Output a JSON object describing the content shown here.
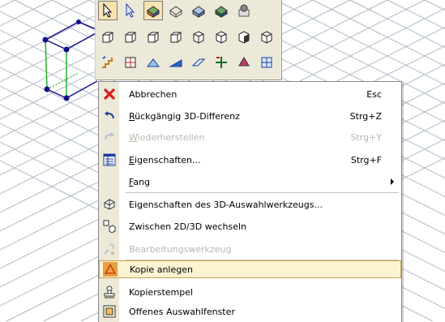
{
  "toolbar": {
    "row1_icons": [
      "pointer-icon",
      "pointer-alt-icon",
      "render-shaded-icon",
      "render-wire-icon",
      "render-hidden-icon",
      "render-color-icon",
      "render-settings-icon"
    ],
    "row2_icons": [
      "box-1-icon",
      "box-2-icon",
      "box-3-icon",
      "box-4-icon",
      "cube-1-icon",
      "cube-2-icon",
      "cube-3-icon",
      "cube-4-icon"
    ],
    "row3_icons": [
      "stairs-icon",
      "grid-icon",
      "roof-icon",
      "slope-icon",
      "plane-icon",
      "move-icon",
      "pyramid-icon",
      "snap-icon"
    ]
  },
  "menu": {
    "items": [
      {
        "label": "Abbrechen",
        "shortcut": "Esc",
        "icon": "cancel-x-icon",
        "disabled": false
      },
      {
        "label_pre": "",
        "label_u": "R",
        "label_post": "ückgängig 3D-Differenz",
        "shortcut": "Strg+Z",
        "icon": "undo-icon",
        "disabled": false
      },
      {
        "label_pre": "",
        "label_u": "W",
        "label_post": "iederherstellen",
        "shortcut": "Strg+Y",
        "icon": "redo-icon",
        "disabled": true
      },
      {
        "label_pre": "",
        "label_u": "E",
        "label_post": "igenschaften...",
        "shortcut": "Strg+F",
        "icon": "properties-icon",
        "disabled": false
      },
      {
        "label_pre": "",
        "label_u": "F",
        "label_post": "ang",
        "shortcut": "",
        "icon": "",
        "disabled": false,
        "submenu": true
      },
      {
        "label": "Eigenschaften des 3D-Auswahlwerkzeugs...",
        "shortcut": "",
        "icon": "tool-properties-icon",
        "disabled": false
      },
      {
        "label": "Zwischen 2D/3D wechseln",
        "shortcut": "",
        "icon": "toggle-2d3d-icon",
        "disabled": false
      },
      {
        "label": "Bearbeitungswerkzeug",
        "shortcut": "",
        "icon": "edit-tool-icon",
        "disabled": true
      },
      {
        "label": "Kopie anlegen",
        "shortcut": "",
        "icon": "create-copy-icon",
        "disabled": false,
        "highlighted": true
      },
      {
        "label": "Kopierstempel",
        "shortcut": "",
        "icon": "copy-stamp-icon",
        "disabled": false
      },
      {
        "label": "Offenes Auswahlfenster",
        "shortcut": "",
        "icon": "selection-window-icon",
        "disabled": false
      }
    ]
  },
  "colors": {
    "grid": "#a9b4c2",
    "selection_green": "#25b025",
    "handle": "#10108a",
    "menu_gutter": "#ece9d8",
    "highlight_fill": "#fcf3d2",
    "highlight_border": "#c9a24f",
    "disabled_text": "#b8b6ad"
  }
}
